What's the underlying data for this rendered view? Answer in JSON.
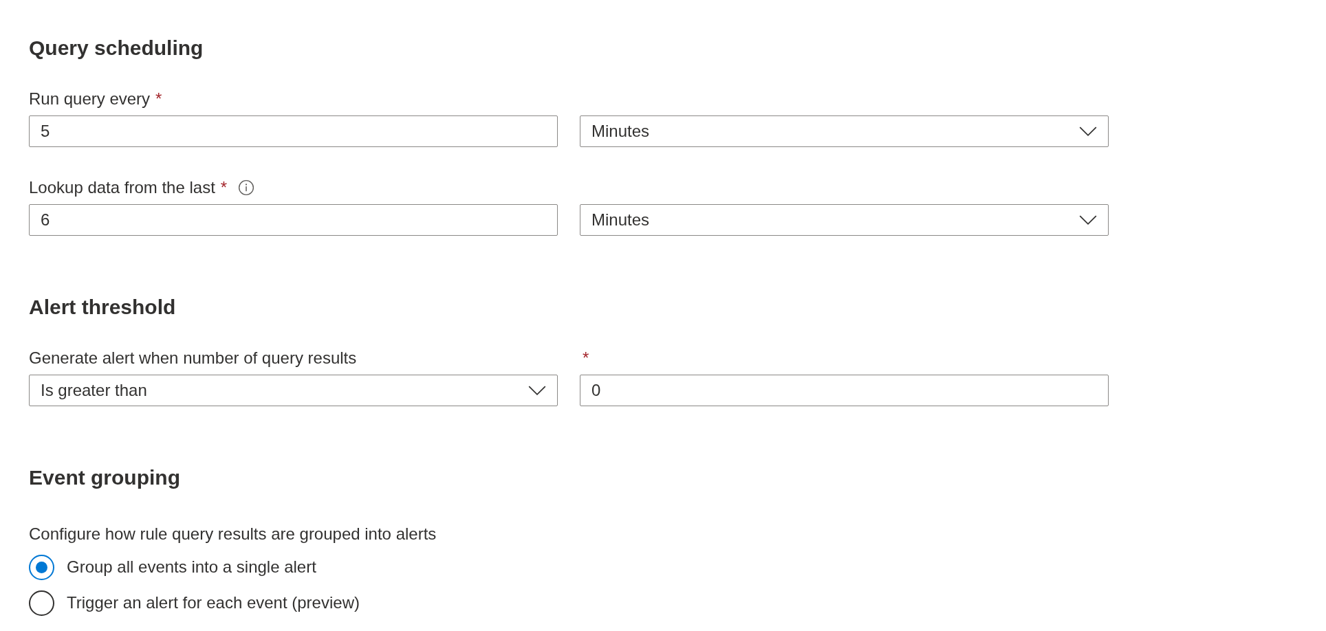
{
  "sections": [
    {
      "heading": "Query scheduling",
      "rows": [
        {
          "fields": [
            {
              "kind": "text",
              "label": "Run query every",
              "required_mark": "*",
              "value": "5"
            },
            {
              "kind": "dropdown",
              "value": "Minutes"
            }
          ]
        },
        {
          "fields": [
            {
              "kind": "text",
              "label": "Lookup data from the last",
              "required_mark": "*",
              "info": true,
              "value": "6"
            },
            {
              "kind": "dropdown",
              "value": "Minutes"
            }
          ]
        }
      ]
    },
    {
      "heading": "Alert threshold",
      "rows": [
        {
          "fields": [
            {
              "kind": "dropdown",
              "label": "Generate alert when number of query results",
              "value": "Is greater than"
            },
            {
              "kind": "text",
              "required_mark": "*",
              "value": "0"
            }
          ]
        }
      ]
    }
  ],
  "event_grouping": {
    "heading": "Event grouping",
    "description": "Configure how rule query results are grouped into alerts",
    "options": [
      {
        "label": "Group all events into a single alert",
        "selected": true
      },
      {
        "label": "Trigger an alert for each event (preview)",
        "selected": false
      }
    ]
  }
}
